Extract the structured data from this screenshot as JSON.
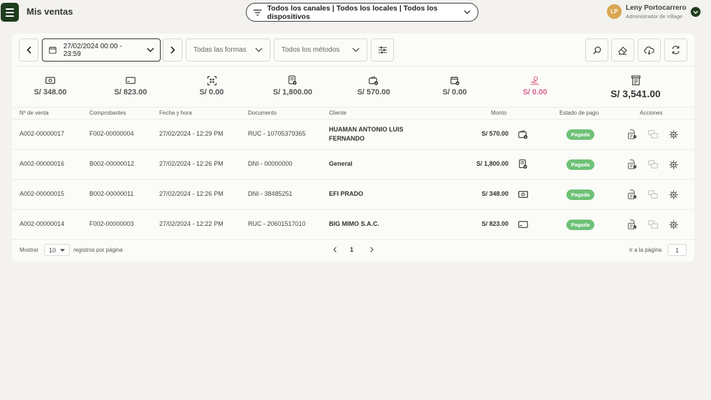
{
  "header": {
    "title": "Mis ventas",
    "filter": "Todos los canales | Todos los locales | Todos los dispositivos",
    "user": {
      "initials": "LP",
      "name": "Leny Portocarrero",
      "role": "Administrador de Village"
    }
  },
  "toolbar": {
    "date_range": "27/02/2024 00:00 - 23:59",
    "forms_select": "Todas las formas",
    "methods_select": "Todos los métodos"
  },
  "summary": [
    {
      "icon": "cash-icon",
      "value": "S/ 348.00"
    },
    {
      "icon": "card-icon",
      "value": "S/ 823.00"
    },
    {
      "icon": "qr-icon",
      "value": "S/ 0.00"
    },
    {
      "icon": "receipt-check-icon",
      "value": "S/ 1,800.00"
    },
    {
      "icon": "wallet-check-icon",
      "value": "S/ 570.00"
    },
    {
      "icon": "calendar-check-icon",
      "value": "S/ 0.00"
    },
    {
      "icon": "hand-coin-icon",
      "value": "S/ 0.00",
      "color": "#d9628d"
    },
    {
      "icon": "register-icon",
      "value": "S/ 3,541.00"
    }
  ],
  "table": {
    "headers": {
      "sale": "Nº de venta",
      "voucher": "Comprobantes",
      "datetime": "Fecha y hora",
      "document": "Documento",
      "client": "Cliente",
      "amount": "Monto",
      "status": "Estado de pago",
      "actions": "Acciones"
    },
    "rows": [
      {
        "sale": "A002-00000017",
        "voucher": "F002-00000004",
        "datetime": "27/02/2024 - 12:29 PM",
        "document": "RUC - 10705379365",
        "client": "HUAMAN ANTONIO LUIS FERNANDO",
        "amount": "S/ 570.00",
        "method_icon": "wallet-check-icon",
        "status": "Pagada"
      },
      {
        "sale": "A002-00000016",
        "voucher": "B002-00000012",
        "datetime": "27/02/2024 - 12:26 PM",
        "document": "DNI - 00000000",
        "client": "General",
        "amount": "S/ 1,800.00",
        "method_icon": "receipt-check-icon",
        "status": "Pagada"
      },
      {
        "sale": "A002-00000015",
        "voucher": "B002-00000011",
        "datetime": "27/02/2024 - 12:26 PM",
        "document": "DNI - 38485251",
        "client": "EFI PRADO",
        "amount": "S/ 348.00",
        "method_icon": "cash-icon",
        "status": "Pagada"
      },
      {
        "sale": "A002-00000014",
        "voucher": "F002-00000003",
        "datetime": "27/02/2024 - 12:22 PM",
        "document": "RUC - 20601517010",
        "client": "BIG MIMO S.A.C.",
        "amount": "S/ 823.00",
        "method_icon": "card-icon",
        "status": "Pagada"
      }
    ]
  },
  "pagination": {
    "show_label": "Mostrar",
    "per_page": "10",
    "per_page_label": "registros por página",
    "current_page": "1",
    "goto_label": "Ir a la página",
    "goto_value": "1"
  }
}
